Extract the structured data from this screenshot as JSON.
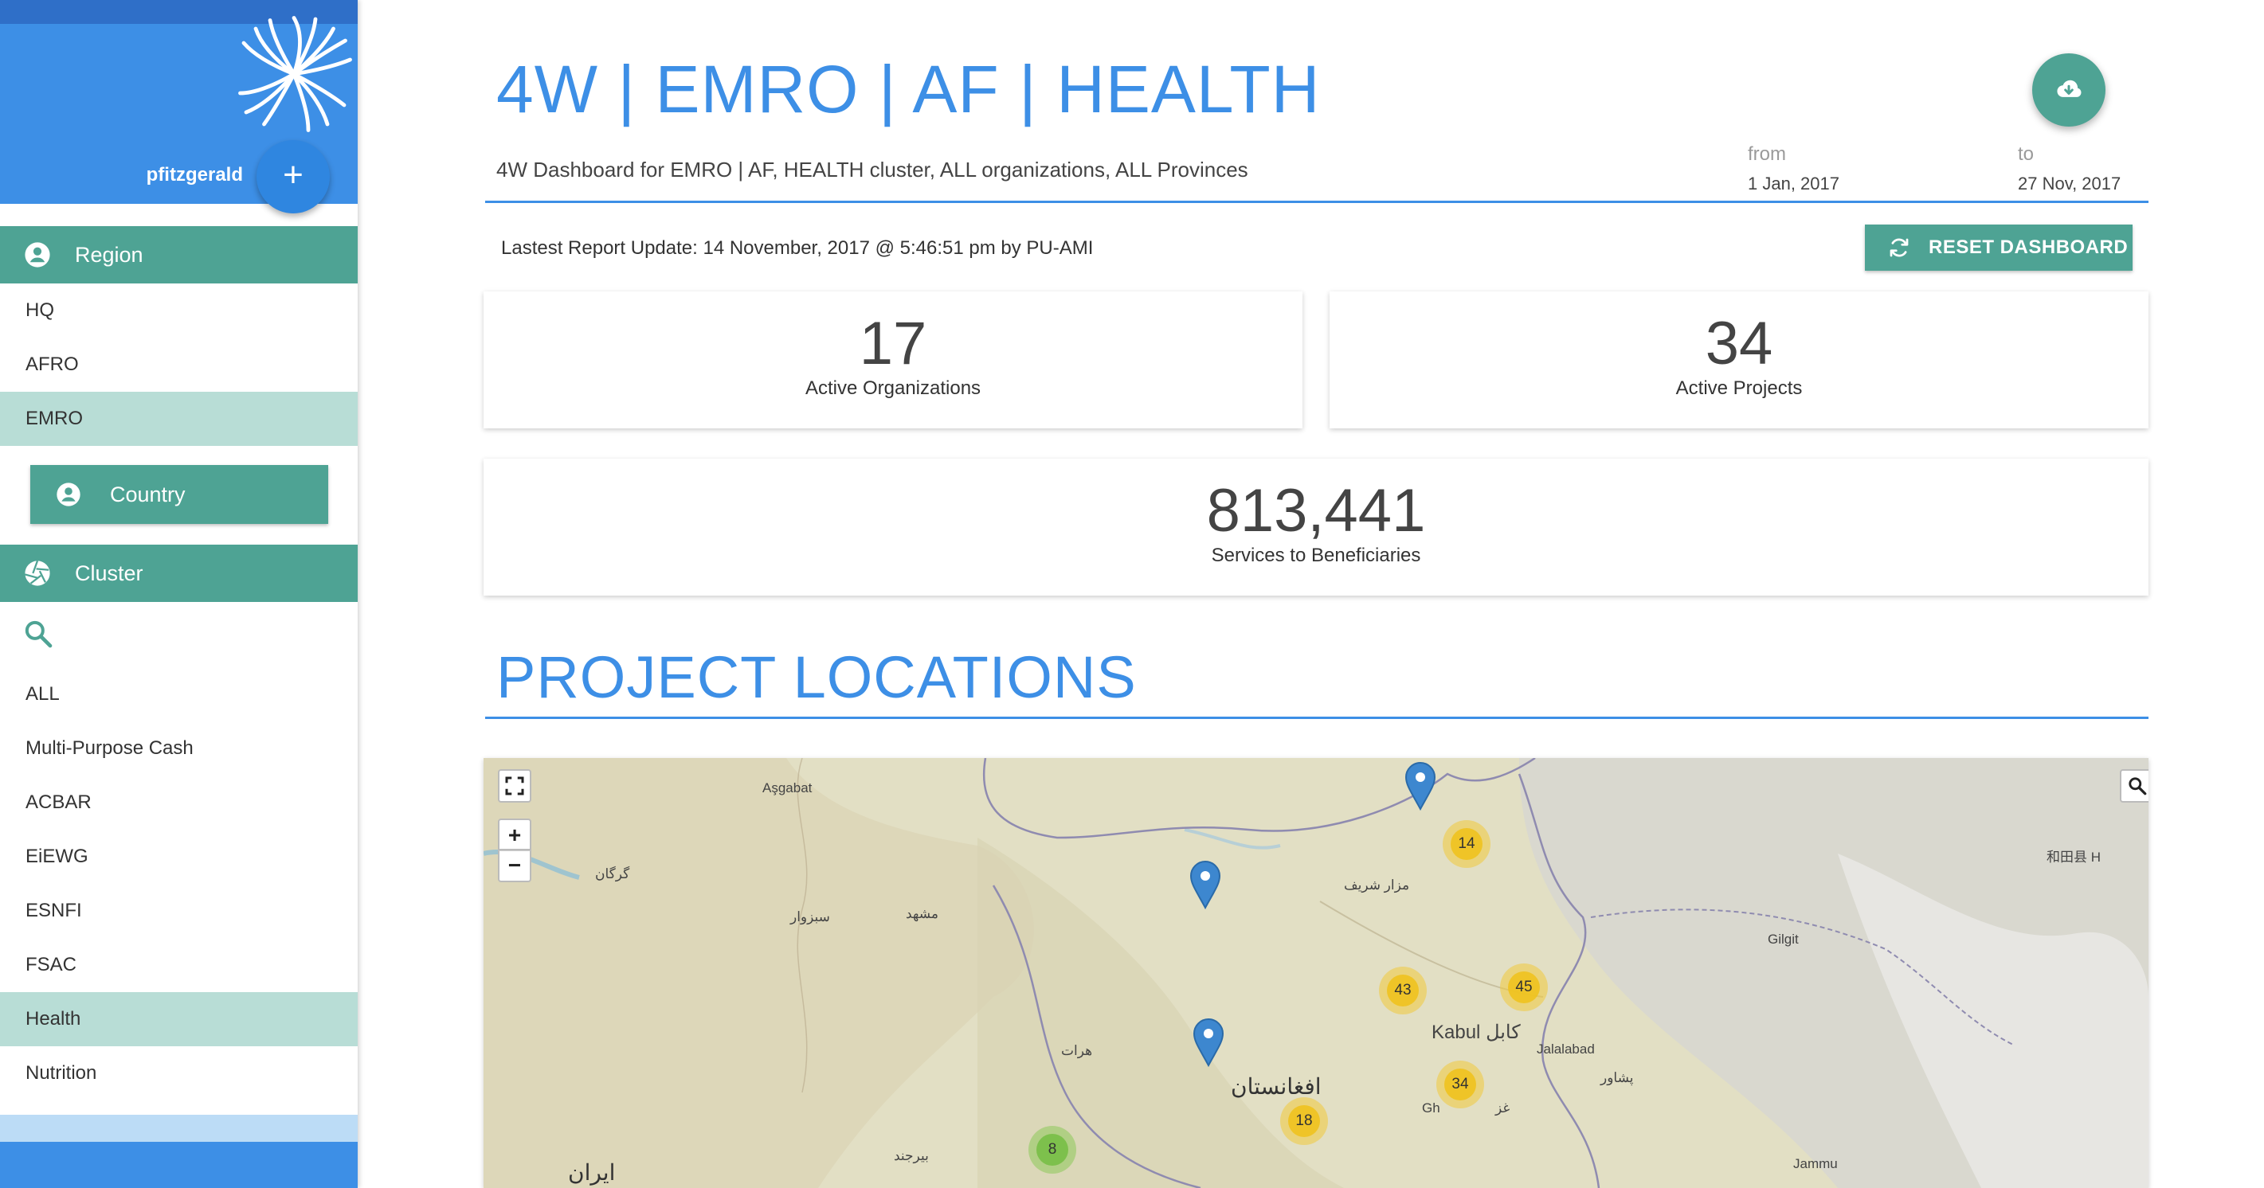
{
  "sidebar": {
    "username": "pfitzgerald",
    "add_label": "+",
    "region_header": "Region",
    "regions": [
      "HQ",
      "AFRO",
      "EMRO"
    ],
    "active_region": "EMRO",
    "country_label": "Country",
    "cluster_header": "Cluster",
    "clusters": [
      "ALL",
      "Multi-Purpose Cash",
      "ACBAR",
      "EiEWG",
      "ESNFI",
      "FSAC",
      "Health",
      "Nutrition"
    ],
    "active_cluster": "Health"
  },
  "header": {
    "title": "4W | EMRO | AF | HEALTH",
    "subtitle": "4W Dashboard for EMRO | AF, HEALTH cluster, ALL organizations, ALL Provinces",
    "from_label": "from",
    "from_value": "1 Jan, 2017",
    "to_label": "to",
    "to_value": "27 Nov, 2017",
    "download_icon": "cloud-download-icon"
  },
  "toolbar": {
    "last_update": "Lastest Report Update: 14 November, 2017 @ 5:46:51 pm by PU-AMI",
    "reset_label": "RESET DASHBOARD"
  },
  "stats": {
    "orgs_value": "17",
    "orgs_label": "Active Organizations",
    "projects_value": "34",
    "projects_label": "Active Projects",
    "beneficiaries_value": "813,441",
    "beneficiaries_label": "Services to Beneficiaries"
  },
  "locations": {
    "title": "PROJECT LOCATIONS",
    "zoom_in": "+",
    "zoom_out": "−",
    "clusters": [
      "14",
      "43",
      "45",
      "34",
      "18",
      "8"
    ],
    "places": {
      "ashgabat": "Aşgabat",
      "gorgan": "گرگان",
      "sabzevar": "سبزوار",
      "mashhad": "مشهد",
      "mazar": "مزار شریف",
      "herat": "هرات",
      "afghanistan": "افغانستان",
      "kabul": "Kabul کابل",
      "jalalabad": "Jalalabad",
      "peshawar": "پشاور",
      "ghazni": "Gh",
      "ghazni2": "غز",
      "gilgit": "Gilgit",
      "hotan": "和田县 H",
      "birjand": "بیرجند",
      "iran": "ایران",
      "jammu": "Jammu"
    }
  },
  "colors": {
    "primary_blue": "#3d8fe6",
    "teal": "#4ea394",
    "active_bg": "#b8ddd6"
  }
}
